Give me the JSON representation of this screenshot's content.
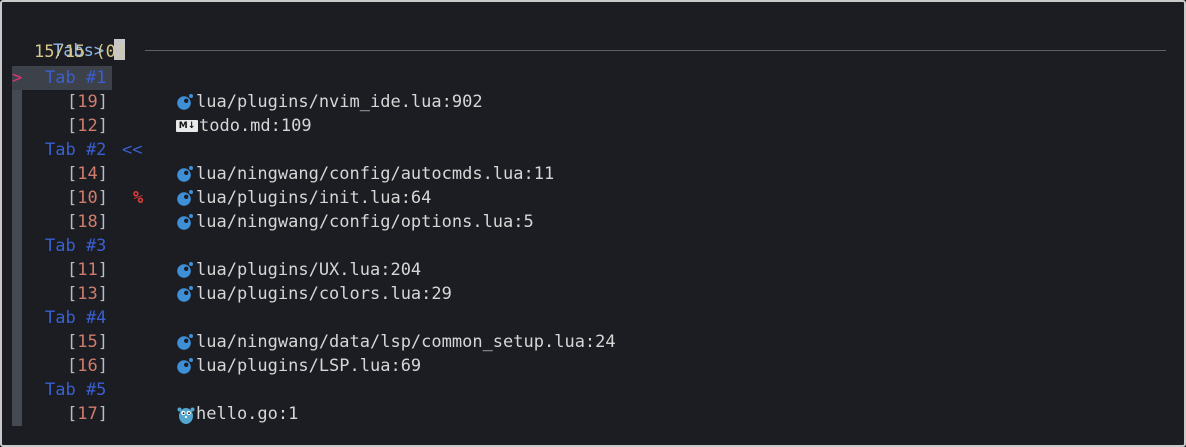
{
  "prompt": {
    "label": "Tabs>",
    "value": ""
  },
  "status": {
    "count": "15/15 (0)"
  },
  "colors": {
    "lua_icon": "#3f8fd6",
    "go_icon": "#52a6d0",
    "tab_label": "#3a5fd0",
    "pointer": "#e0337a",
    "buffer_number": "#d07c6c",
    "modified_flag": "#e03c3c"
  },
  "pointer_glyph": ">",
  "bracket_open": "[",
  "bracket_close": "]",
  "tabs": [
    {
      "label": "Tab #1",
      "mark": "",
      "selected": true,
      "buffers": [
        {
          "num": "19",
          "flag": "",
          "icon": "lua-icon",
          "path": "lua/plugins/nvim_ide.lua:902"
        },
        {
          "num": "12",
          "flag": "",
          "icon": "markdown-icon",
          "icon_text": "M↓",
          "path": "todo.md:109"
        }
      ]
    },
    {
      "label": "Tab #2",
      "mark": "<<",
      "selected": false,
      "buffers": [
        {
          "num": "14",
          "flag": "",
          "icon": "lua-icon",
          "path": "lua/ningwang/config/autocmds.lua:11"
        },
        {
          "num": "10",
          "flag": "%",
          "icon": "lua-icon",
          "path": "lua/plugins/init.lua:64"
        },
        {
          "num": "18",
          "flag": "",
          "icon": "lua-icon",
          "path": "lua/ningwang/config/options.lua:5"
        }
      ]
    },
    {
      "label": "Tab #3",
      "mark": "",
      "selected": false,
      "buffers": [
        {
          "num": "11",
          "flag": "",
          "icon": "lua-icon",
          "path": "lua/plugins/UX.lua:204"
        },
        {
          "num": "13",
          "flag": "",
          "icon": "lua-icon",
          "path": "lua/plugins/colors.lua:29"
        }
      ]
    },
    {
      "label": "Tab #4",
      "mark": "",
      "selected": false,
      "buffers": [
        {
          "num": "15",
          "flag": "",
          "icon": "lua-icon",
          "path": "lua/ningwang/data/lsp/common_setup.lua:24"
        },
        {
          "num": "16",
          "flag": "",
          "icon": "lua-icon",
          "path": "lua/plugins/LSP.lua:69"
        }
      ]
    },
    {
      "label": "Tab #5",
      "mark": "",
      "selected": false,
      "buffers": [
        {
          "num": "17",
          "flag": "",
          "icon": "go-icon",
          "path": "hello.go:1"
        }
      ]
    }
  ]
}
